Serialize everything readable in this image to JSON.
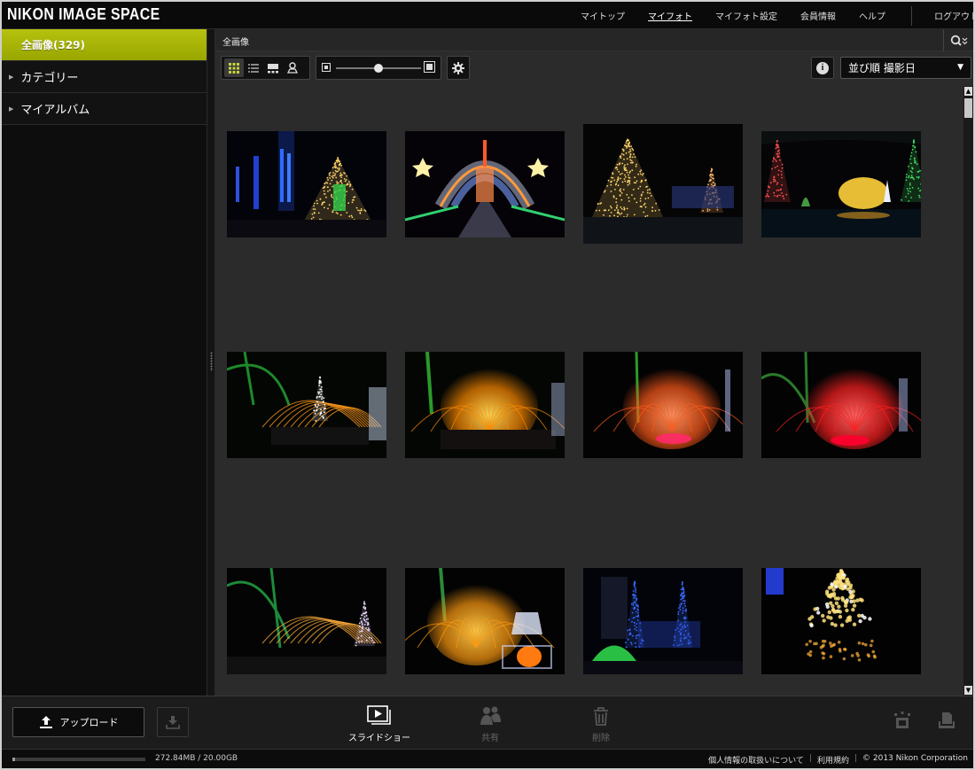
{
  "app": {
    "logo": "NIKON IMAGE SPACE"
  },
  "topnav": {
    "items": [
      {
        "label": "マイトップ",
        "active": false
      },
      {
        "label": "マイフォト",
        "active": true
      },
      {
        "label": "マイフォト設定",
        "active": false
      },
      {
        "label": "会員情報",
        "active": false
      },
      {
        "label": "ヘルプ",
        "active": false
      }
    ],
    "logout": "ログアウト"
  },
  "sidebar": {
    "items": [
      {
        "label": "全画像(329)",
        "selected": true
      },
      {
        "label": "カテゴリー",
        "selected": false
      },
      {
        "label": "マイアルバム",
        "selected": false
      }
    ]
  },
  "breadcrumb": {
    "label": "全画像"
  },
  "toolbar": {
    "view_modes": [
      "grid-view-icon",
      "list-view-icon",
      "filmstrip-view-icon",
      "map-view-icon"
    ],
    "active_view": "grid-view-icon",
    "thumbnail_size_level": 0.62,
    "sort": {
      "label": "並び順 撮影日"
    }
  },
  "gallery": {
    "photos": [
      {
        "name": "photo-illuminated-tree-blue-tower",
        "scene": "tree-blue"
      },
      {
        "name": "photo-light-tunnel-stars",
        "scene": "tunnel"
      },
      {
        "name": "photo-illuminated-tree-night",
        "scene": "tree-gold"
      },
      {
        "name": "photo-light-cones-fountain",
        "scene": "cones"
      },
      {
        "name": "photo-fountain-orange-arcs",
        "scene": "fountain-arc"
      },
      {
        "name": "photo-fountain-orange-burst",
        "scene": "fountain-orange"
      },
      {
        "name": "photo-fountain-red-orange",
        "scene": "fountain-redorange"
      },
      {
        "name": "photo-fountain-red",
        "scene": "fountain-red"
      },
      {
        "name": "photo-fountain-arcs-tree",
        "scene": "fountain-arc2"
      },
      {
        "name": "photo-fountain-orange-reindeer",
        "scene": "fountain-deer"
      },
      {
        "name": "photo-blue-light-trees",
        "scene": "blue-trees"
      },
      {
        "name": "photo-bokeh-tree-reflection",
        "scene": "bokeh"
      }
    ]
  },
  "actions": {
    "upload": "アップロード",
    "slideshow": "スライドショー",
    "share": "共有",
    "delete": "削除"
  },
  "footer": {
    "storage_used": "272.84MB / 20.00GB",
    "storage_fraction": 0.013,
    "privacy": "個人情報の取扱いについて",
    "terms": "利用規約",
    "copyright": "© 2013 Nikon Corporation"
  },
  "colors": {
    "selected": "#a8b50a",
    "background": "#2b2b2b"
  }
}
